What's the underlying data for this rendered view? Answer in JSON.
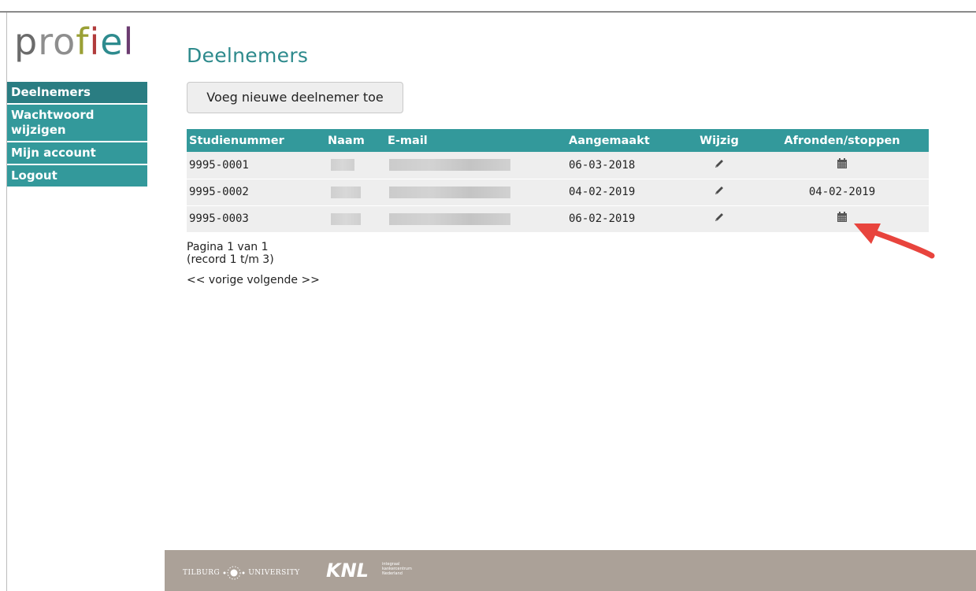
{
  "logo": {
    "parts": [
      "p",
      "ro",
      "f",
      "i",
      "e",
      "l"
    ]
  },
  "sidebar": {
    "items": [
      {
        "label": "Deelnemers",
        "active": true
      },
      {
        "label": "Wachtwoord wijzigen",
        "active": false
      },
      {
        "label": "Mijn account",
        "active": false
      },
      {
        "label": "Logout",
        "active": false
      }
    ]
  },
  "main": {
    "title": "Deelnemers",
    "add_button_label": "Voeg nieuwe deelnemer toe"
  },
  "table": {
    "columns": [
      "Studienummer",
      "Naam",
      "E-mail",
      "Aangemaakt",
      "Wijzig",
      "Afronden/stoppen"
    ],
    "rows": [
      {
        "studienummer": "9995-0001",
        "aangemaakt": "06-03-2018",
        "wijzig_icon": "pencil-icon",
        "afronden_icon": "calendar-icon",
        "afronden_text": ""
      },
      {
        "studienummer": "9995-0002",
        "aangemaakt": "04-02-2019",
        "wijzig_icon": "pencil-icon",
        "afronden_icon": "",
        "afronden_text": "04-02-2019"
      },
      {
        "studienummer": "9995-0003",
        "aangemaakt": "06-02-2019",
        "wijzig_icon": "pencil-icon",
        "afronden_icon": "calendar-icon",
        "afronden_text": ""
      }
    ]
  },
  "pager": {
    "text": "Pagina 1 van 1 (record 1 t/m 3)",
    "prev": "<< vorige",
    "next": "volgende >>"
  },
  "footer": {
    "tilburg_left": "TILBURG",
    "tilburg_right": "UNIVERSITY",
    "knl": "KNL",
    "knl_sub": [
      "integraal",
      "kankercentrum",
      "Nederland"
    ]
  },
  "colors": {
    "teal": "#33999b",
    "teal_dark": "#2a7d82",
    "title": "#2d8a8c",
    "footer": "#aba198",
    "arrow": "#e8443d"
  }
}
